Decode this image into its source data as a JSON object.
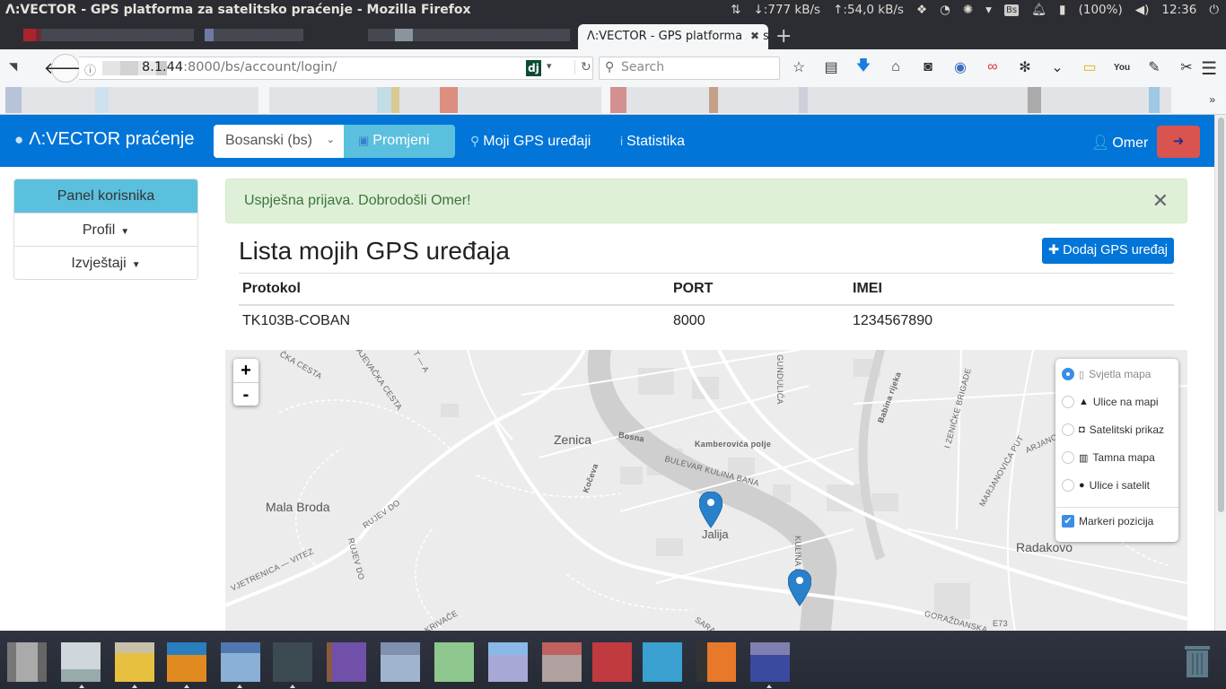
{
  "os": {
    "window_title": "Λ:VECTOR - GPS platforma za satelitsko praćenje - Mozilla Firefox",
    "net_down": "↓:777 kB/s",
    "net_up": "↑:54,0 kB/s",
    "battery": "(100%)",
    "clock": "12:36",
    "indicators": [
      "network-transfer-icon",
      "dropbox-icon",
      "clock-app-icon",
      "pinwheel-icon",
      "wifi-icon",
      "keyboard-layout-icon",
      "notification-bell-icon",
      "battery-icon",
      "volume-icon",
      "power-icon"
    ],
    "keyboard_layout": "Bs"
  },
  "browser": {
    "active_tab_title": "Λ:VECTOR - GPS platforma za satelitsko praćenje",
    "url_host_partial": "8.1.44",
    "url_rest": ":8000/bs/account/login/",
    "search_placeholder": "Search",
    "dj_badge": "dj"
  },
  "app": {
    "brand": "Λ:VECTOR praćenje",
    "language_select": "Bosanski (bs)",
    "change_button": "Promjeni",
    "nav_links": [
      {
        "label": "Moji GPS uređaji",
        "icon": "map-marker-icon"
      },
      {
        "label": "Statistika",
        "icon": "info-icon"
      }
    ],
    "user_name": "Omer",
    "colors": {
      "primary": "#0175d8",
      "info": "#5bc0de",
      "danger": "#d9534f",
      "success_bg": "#dff0d8",
      "success_text": "#3c763d"
    }
  },
  "sidebar": {
    "title": "Panel korisnika",
    "items": [
      {
        "label": "Profil"
      },
      {
        "label": "Izvještaji"
      }
    ]
  },
  "alert": {
    "message": "Uspješna prijava. Dobrodošli Omer!",
    "close": "✕"
  },
  "devices": {
    "title": "Lista mojih GPS uređaja",
    "add_button": "Dodaj GPS uređaj",
    "columns": [
      "Protokol",
      "PORT",
      "IMEI"
    ],
    "rows": [
      [
        "TK103B-COBAN",
        "8000",
        "1234567890"
      ]
    ]
  },
  "map": {
    "zoom_in": "+",
    "zoom_out": "-",
    "layers": [
      {
        "label": "Svjetla mapa",
        "selected": true,
        "icon": "map-outline-icon"
      },
      {
        "label": "Ulice na mapi",
        "selected": false,
        "icon": "road-icon"
      },
      {
        "label": "Satelitski prikaz",
        "selected": false,
        "icon": "camera-icon"
      },
      {
        "label": "Tamna mapa",
        "selected": false,
        "icon": "map-icon"
      },
      {
        "label": "Ulice i satelit",
        "selected": false,
        "icon": "globe-icon"
      }
    ],
    "overlay": {
      "label": "Markeri pozicija",
      "checked": true
    },
    "places": [
      "Zenica",
      "Mala Broda",
      "Jalija",
      "Radakovo"
    ],
    "streets": [
      "ZMAJEVAČKA CESTA",
      "ČKA CESTA",
      "RUJEV DO",
      "RUJEV DO",
      "VJETRENICA — VITEZ",
      "KRIVAČE",
      "Kočeva",
      "Bosna",
      "Kamberovića polje",
      "BULEVAR KULINA BANA",
      "KULINA BAN",
      "Babina rijeka",
      "I ZENIČKE BRIGADE",
      "MARJANOVIĆA PUT",
      "ARJANOV",
      "GORAŽDANSKA",
      "E73",
      "GUNDULIĆA",
      "SARA",
      "T — A"
    ],
    "markers": 2
  },
  "dock": {
    "apps": 15
  }
}
